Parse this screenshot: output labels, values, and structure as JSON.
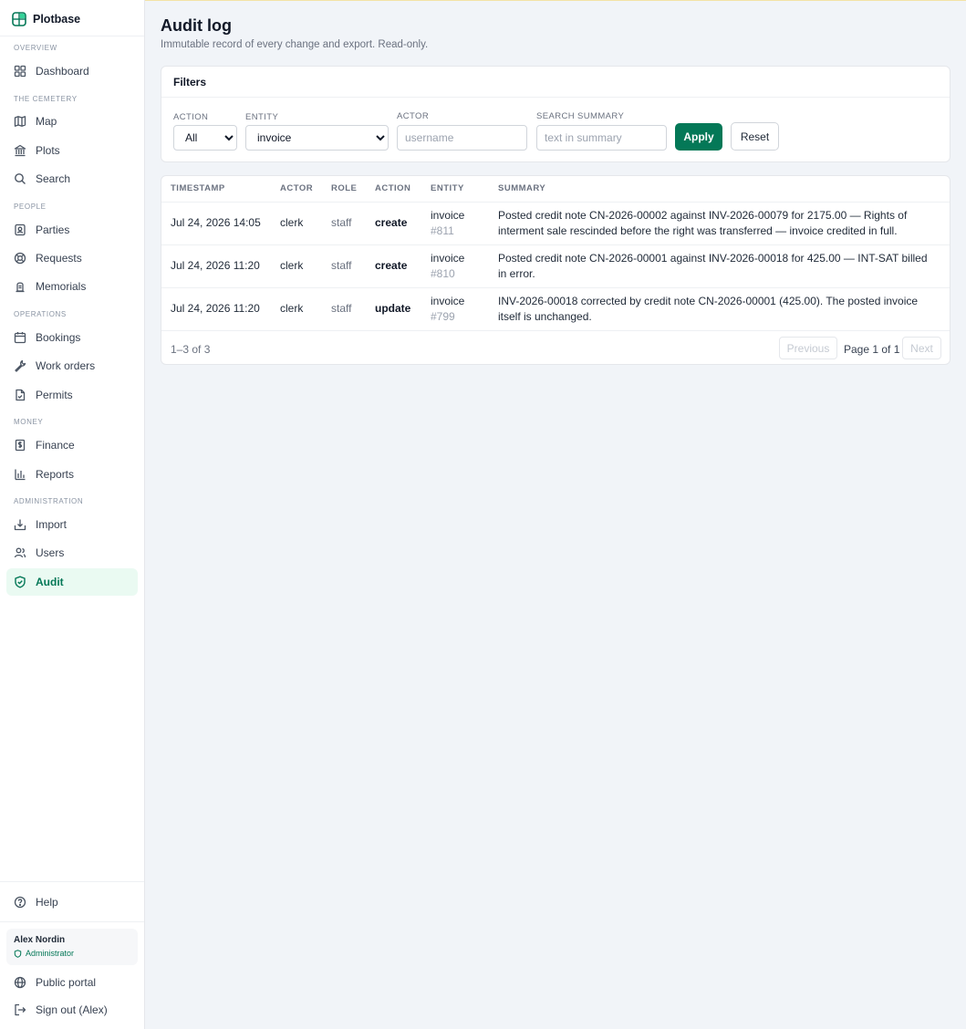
{
  "app": {
    "name": "Plotbase"
  },
  "sidebar": {
    "sections": {
      "overview": "OVERVIEW",
      "cemetery": "THE CEMETERY",
      "people": "PEOPLE",
      "operations": "OPERATIONS",
      "money": "MONEY",
      "administration": "ADMINISTRATION"
    },
    "items": {
      "dashboard": "Dashboard",
      "map": "Map",
      "plots": "Plots",
      "search": "Search",
      "parties": "Parties",
      "requests": "Requests",
      "memorials": "Memorials",
      "bookings": "Bookings",
      "work_orders": "Work orders",
      "permits": "Permits",
      "finance": "Finance",
      "reports": "Reports",
      "import": "Import",
      "users": "Users",
      "audit": "Audit"
    },
    "active": "audit",
    "help": "Help",
    "user": {
      "name": "Alex Nordin",
      "role": "Administrator"
    },
    "public_portal": "Public portal",
    "sign_out": "Sign out (Alex)"
  },
  "page": {
    "title": "Audit log",
    "subtitle": "Immutable record of every change and export. Read-only."
  },
  "filters": {
    "heading": "Filters",
    "action_label": "ACTION",
    "action_value": "All",
    "entity_label": "ENTITY",
    "entity_value": "invoice",
    "actor_label": "ACTOR",
    "actor_placeholder": "username",
    "search_label": "SEARCH SUMMARY",
    "search_placeholder": "text in summary",
    "apply": "Apply",
    "reset": "Reset"
  },
  "table": {
    "columns": [
      "TIMESTAMP",
      "ACTOR",
      "ROLE",
      "ACTION",
      "ENTITY",
      "SUMMARY"
    ],
    "rows": [
      {
        "timestamp": "Jul 24, 2026 14:05",
        "actor": "clerk",
        "role": "staff",
        "action": "create",
        "entity": "invoice",
        "entity_id": "#811",
        "summary": "Posted credit note CN-2026-00002 against INV-2026-00079 for 2175.00 — Rights of interment sale rescinded before the right was transferred — invoice credited in full."
      },
      {
        "timestamp": "Jul 24, 2026 11:20",
        "actor": "clerk",
        "role": "staff",
        "action": "create",
        "entity": "invoice",
        "entity_id": "#810",
        "summary": "Posted credit note CN-2026-00001 against INV-2026-00018 for 425.00 — INT-SAT billed in error."
      },
      {
        "timestamp": "Jul 24, 2026 11:20",
        "actor": "clerk",
        "role": "staff",
        "action": "update",
        "entity": "invoice",
        "entity_id": "#799",
        "summary": "INV-2026-00018 corrected by credit note CN-2026-00001 (425.00). The posted invoice itself is unchanged."
      }
    ],
    "range": "1–3 of 3",
    "previous": "Previous",
    "page_info": "Page 1 of 1",
    "next": "Next"
  },
  "colors": {
    "accent": "#047857",
    "active_bg": "#eafaf2",
    "page_bg": "#f1f4f8"
  }
}
